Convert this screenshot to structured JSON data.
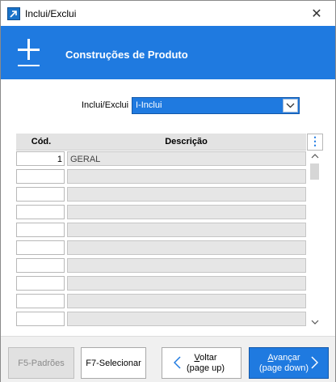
{
  "window": {
    "title": "Inclui/Exclui",
    "close_glyph": "✕"
  },
  "header": {
    "icon": "plus-icon",
    "title": "Construções de Produto",
    "color": "#1f7ae0"
  },
  "form": {
    "label": "Inclui/Exclui",
    "select_value": "I-Inclui",
    "select_arrow": "⌵"
  },
  "grid": {
    "columns": [
      "Cód.",
      "Descrição"
    ],
    "menu_glyph": "⋮",
    "rows": [
      {
        "cod": "1",
        "desc": "GERAL"
      },
      {
        "cod": "",
        "desc": ""
      },
      {
        "cod": "",
        "desc": ""
      },
      {
        "cod": "",
        "desc": ""
      },
      {
        "cod": "",
        "desc": ""
      },
      {
        "cod": "",
        "desc": ""
      },
      {
        "cod": "",
        "desc": ""
      },
      {
        "cod": "",
        "desc": ""
      },
      {
        "cod": "",
        "desc": ""
      },
      {
        "cod": "",
        "desc": ""
      }
    ],
    "scroll_up": "⌃",
    "scroll_down": "⌄"
  },
  "footer": {
    "f5_label": "F5-Padrões",
    "f7_label": "F7-Selecionar",
    "voltar_line1_first": "V",
    "voltar_line1_rest": "oltar",
    "voltar_line2": "(page up)",
    "avancar_line1_first": "A",
    "avancar_line1_rest": "vançar",
    "avancar_line2": "(page down)",
    "chev_left": "❮",
    "chev_right": "❯"
  }
}
